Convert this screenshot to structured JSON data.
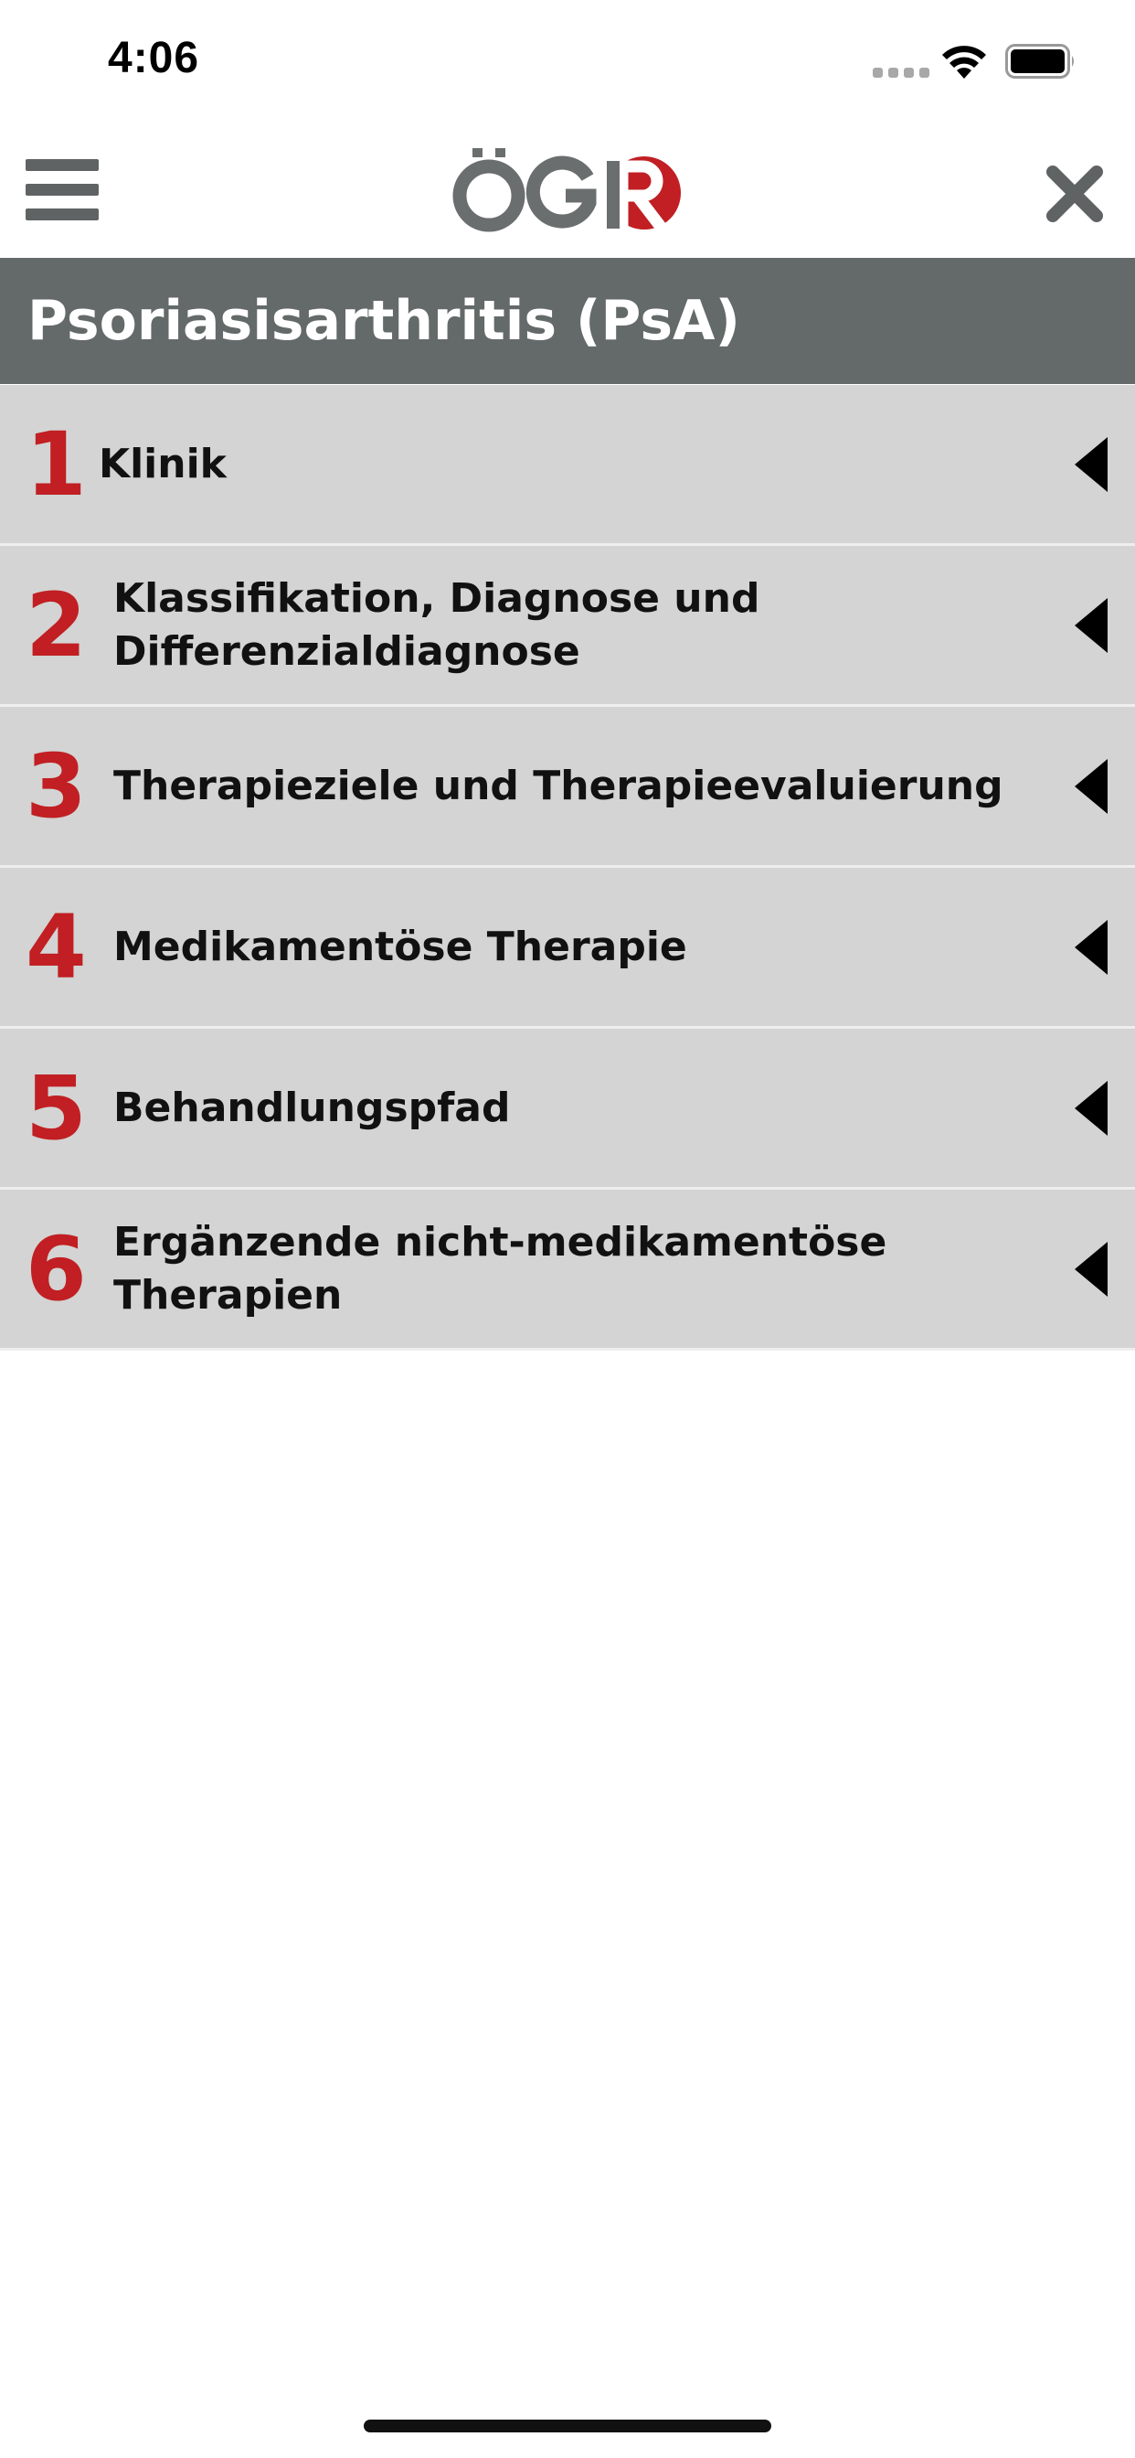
{
  "status_bar": {
    "time": "4:06"
  },
  "nav": {
    "logo_text": "ÖGR",
    "logo_colors": {
      "grey": "#6a6e6e",
      "red": "#c11f23"
    }
  },
  "header": {
    "title": "Psoriasisarthritis (PsA)"
  },
  "menu": {
    "items": [
      {
        "number": "1",
        "label": "Klinik"
      },
      {
        "number": "2",
        "label": "Klassifikation, Diagnose und\nDifferenzialdiagnose"
      },
      {
        "number": "3",
        "label": "Therapieziele und Therapieevaluierung"
      },
      {
        "number": "4",
        "label": "Medikamentöse Therapie"
      },
      {
        "number": "5",
        "label": "Behandlungspfad"
      },
      {
        "number": "6",
        "label": "Ergänzende nicht-medikamentöse Therapien"
      }
    ]
  },
  "colors": {
    "accent_red": "#c11f23",
    "header_grey": "#646a69",
    "row_grey": "#d3d4d3"
  }
}
